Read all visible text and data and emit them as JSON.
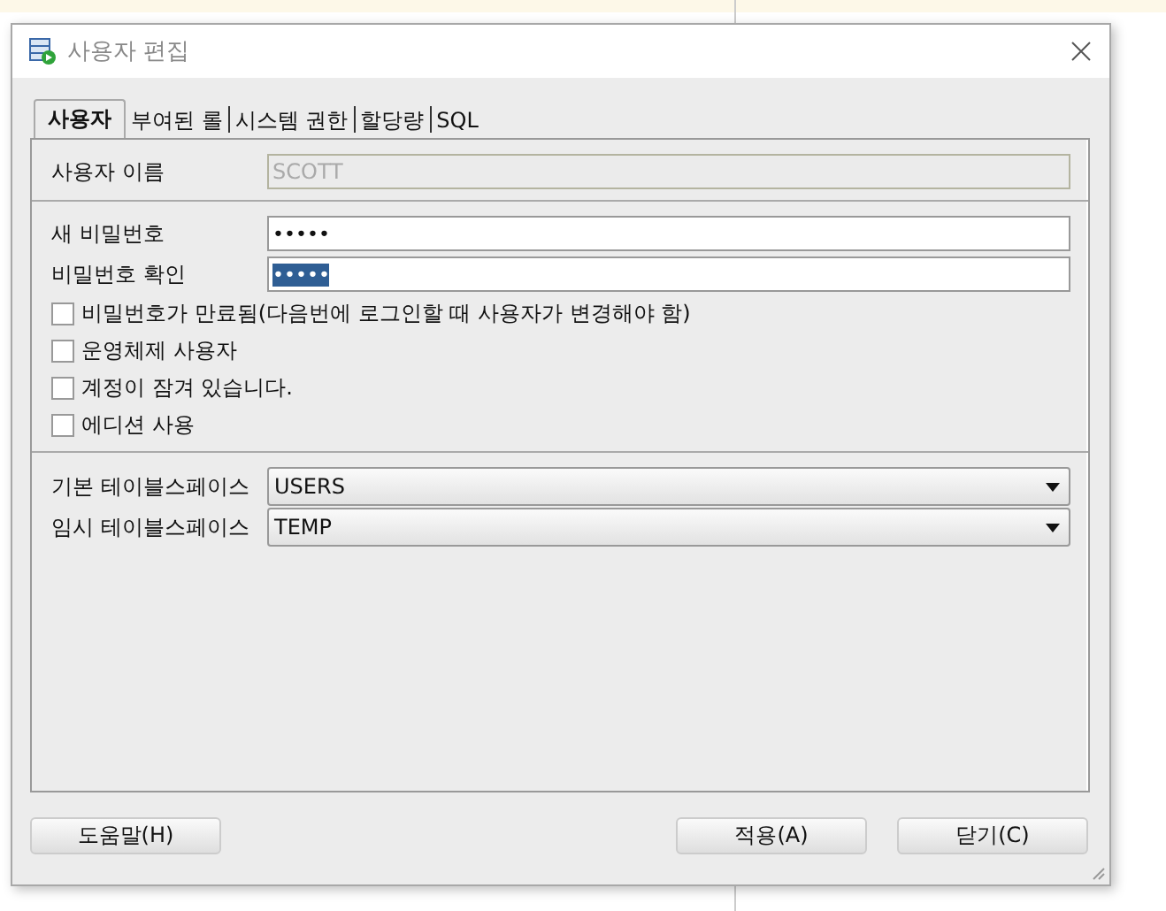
{
  "window": {
    "title": "사용자 편집"
  },
  "tabs": [
    {
      "label": "사용자",
      "selected": true
    },
    {
      "label": "부여된 롤",
      "selected": false
    },
    {
      "label": "시스템 권한",
      "selected": false
    },
    {
      "label": "할당량",
      "selected": false
    },
    {
      "label": "SQL",
      "selected": false
    }
  ],
  "username": {
    "label": "사용자 이름",
    "value": "SCOTT",
    "disabled": true
  },
  "passwords": [
    {
      "label": "새 비밀번호",
      "value": "•••••",
      "selected": false
    },
    {
      "label": "비밀번호 확인",
      "value": "•••••",
      "selected": true
    }
  ],
  "options": [
    {
      "label": "비밀번호가 만료됨(다음번에 로그인할 때 사용자가 변경해야 함)",
      "checked": false
    },
    {
      "label": "운영체제 사용자",
      "checked": false
    },
    {
      "label": "계정이 잠겨 있습니다.",
      "checked": false
    },
    {
      "label": "에디션 사용",
      "checked": false
    }
  ],
  "tablespaces": [
    {
      "label": "기본 테이블스페이스",
      "value": "USERS"
    },
    {
      "label": "임시 테이블스페이스",
      "value": "TEMP"
    }
  ],
  "buttons": {
    "left": [
      "도움말(H)"
    ],
    "right": [
      "적용(A)",
      "닫기(C)"
    ]
  }
}
